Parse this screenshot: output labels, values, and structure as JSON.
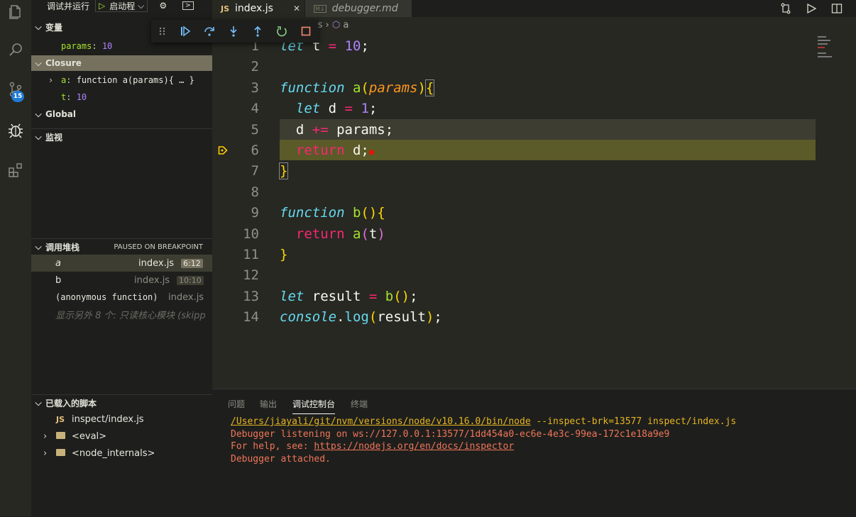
{
  "debug": {
    "title": "调试并运行",
    "config": "启动程",
    "toolbar": [
      "continue",
      "step-over",
      "step-into",
      "step-out",
      "restart",
      "stop"
    ]
  },
  "activity_badge": "15",
  "sidebar": {
    "variables_header": "变量",
    "params_name": "params",
    "params_value": "10",
    "closure_header": "Closure",
    "closure_items": [
      {
        "name": "a",
        "value": "function a(params){ … }"
      },
      {
        "name": "t",
        "value": "10"
      }
    ],
    "global_header": "Global",
    "watch_header": "监视",
    "callstack_header": "调用堆栈",
    "callstack_status": "PAUSED ON BREAKPOINT",
    "frames": [
      {
        "name": "a",
        "file": "index.js",
        "pos": "6:12"
      },
      {
        "name": "b",
        "file": "index.js",
        "pos": "10:10"
      },
      {
        "name": "(anonymous function)",
        "file": "index.js",
        "pos": ""
      }
    ],
    "more_frames": "显示另外 8 个: 只读核心模块 (skipp",
    "loaded_header": "已载入的脚本",
    "scripts": [
      {
        "label": "inspect/index.js",
        "badge": "JS"
      },
      {
        "label": "<eval>"
      },
      {
        "label": "<node_internals>"
      }
    ]
  },
  "tabs": [
    {
      "label": "index.js",
      "badge": "JS",
      "active": true,
      "close": "✕"
    },
    {
      "label": "debugger.md",
      "badge": "M↓",
      "active": false
    }
  ],
  "breadcrumb": {
    "file": "js",
    "symbol": "a"
  },
  "editor": {
    "lines": [
      "1",
      "2",
      "3",
      "4",
      "5",
      "6",
      "7",
      "8",
      "9",
      "10",
      "11",
      "12",
      "13",
      "14"
    ]
  },
  "panel": {
    "tabs": [
      "问题",
      "输出",
      "调试控制台",
      "终端"
    ],
    "active_tab": "调试控制台",
    "lines": [
      {
        "link": "/Users/jiayali/git/nvm/versions/node/v10.16.0/bin/node",
        "rest": " --inspect-brk=13577 inspect/index.js"
      },
      {
        "link": "",
        "rest": "Debugger listening on ws://127.0.0.1:13577/1dd454a0-ec6e-4e3c-99ea-172c1e18a9e9"
      },
      {
        "link": "https://nodejs.org/en/docs/inspector",
        "prefix": "For help, see: ",
        "rest": ""
      },
      {
        "link": "",
        "rest": "Debugger attached."
      }
    ]
  }
}
